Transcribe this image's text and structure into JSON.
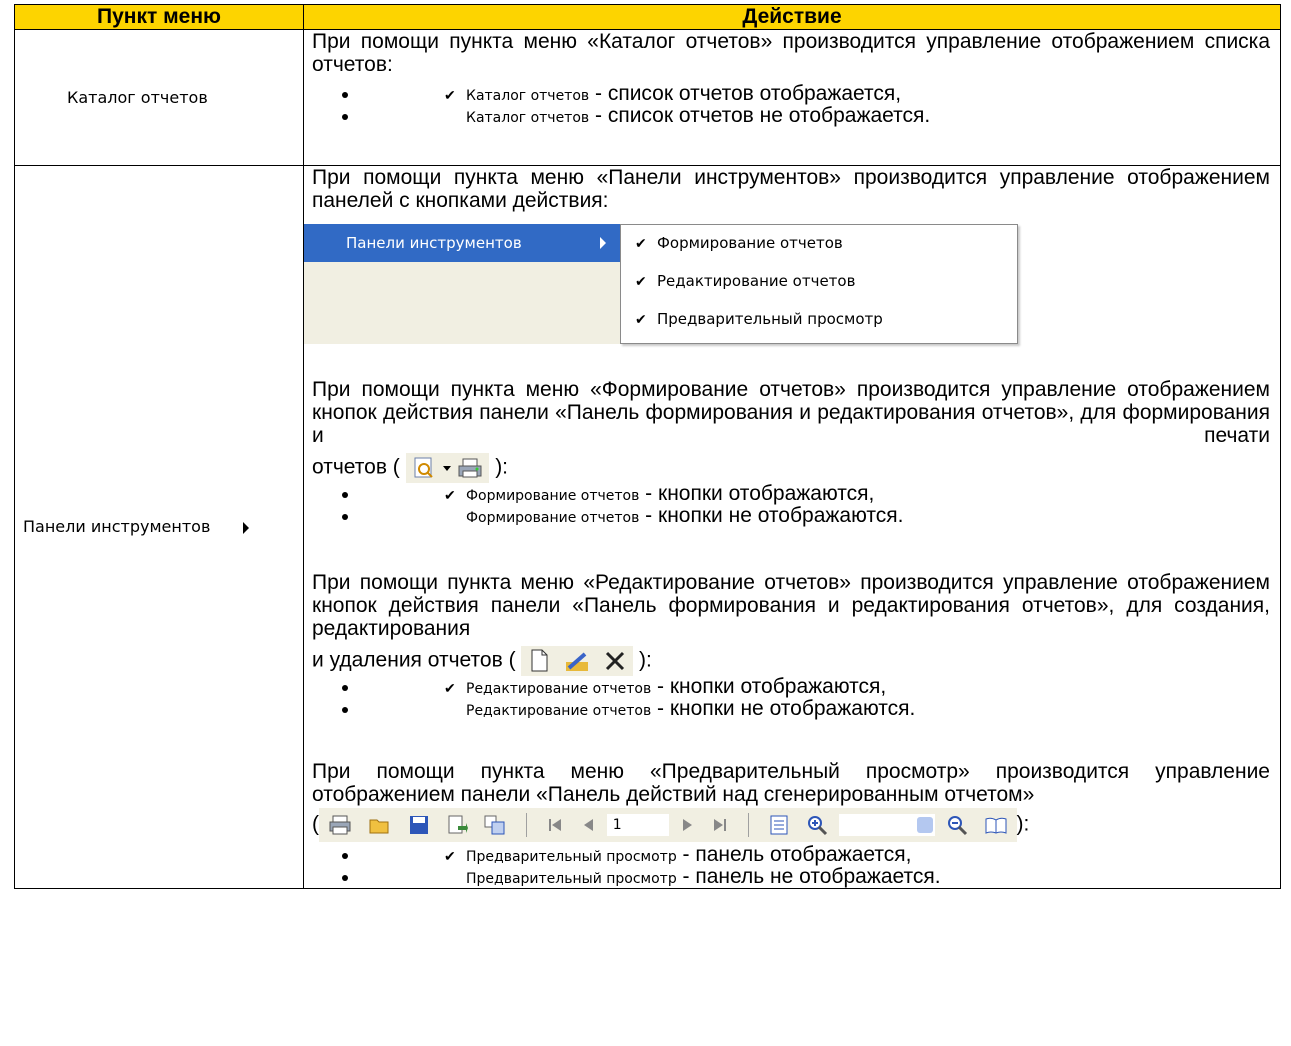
{
  "table": {
    "header": {
      "col1": "Пункт меню",
      "col2": "Действие"
    },
    "row1": {
      "menu_item": "Каталог отчетов",
      "paragraph": "При помощи пункта меню «Каталог отчетов» производится управление отображением списка отчетов:",
      "bullets": [
        {
          "checked": true,
          "ui_label": "Каталог отчетов",
          "text": " - список отчетов отображается,"
        },
        {
          "checked": false,
          "ui_label": "Каталог отчетов",
          "text": " - список отчетов не отображается."
        }
      ]
    },
    "row2": {
      "menu_item": "Панели инструментов",
      "intro": "При помощи пункта меню «Панели инструментов» производится управление отображением панелей с кнопками действия:",
      "submenu": {
        "selected_label": "Панели инструментов",
        "items": [
          "Формирование отчетов",
          "Редактирование отчетов",
          "Предварительный просмотр"
        ]
      },
      "section1": {
        "paragraph": "При помощи пункта меню «Формирование отчетов» производится управление отображением кнопок действия панели «Панель формирования и редактирования отчетов», для формирования и печати",
        "tail_before": "отчетов (",
        "tail_after": "):",
        "icons": [
          "preview-icon",
          "dropdown-arrow-icon",
          "print-icon"
        ],
        "bullets": [
          {
            "checked": true,
            "ui_label": "Формирование отчетов",
            "text": " - кнопки отображаются,"
          },
          {
            "checked": false,
            "ui_label": "Формирование отчетов",
            "text": " - кнопки не отображаются."
          }
        ]
      },
      "section2": {
        "paragraph": "При помощи пункта меню «Редактирование отчетов» производится управление отображением кнопок действия панели «Панель формирования и редактирования отчетов», для создания, редактирования",
        "tail_before": "и удаления отчетов (",
        "tail_after": "):",
        "icons": [
          "new-document-icon",
          "edit-icon",
          "delete-icon"
        ],
        "bullets": [
          {
            "checked": true,
            "ui_label": "Редактирование отчетов",
            "text": " - кнопки отображаются,"
          },
          {
            "checked": false,
            "ui_label": "Редактирование отчетов",
            "text": " - кнопки не отображаются."
          }
        ]
      },
      "section3": {
        "paragraph": "При помощи пункта меню «Предварительный просмотр» производится управление отображением панели «Панель действий над сгенерированным отчетом»",
        "toolbar_open": "(",
        "toolbar_close": "):",
        "page_number": "1",
        "bullets": [
          {
            "checked": true,
            "ui_label": "Предварительный просмотр",
            "text": " - панель отображается,"
          },
          {
            "checked": false,
            "ui_label": "Предварительный просмотр",
            "text": " - панель не отображается."
          }
        ]
      }
    }
  },
  "colors": {
    "header_bg": "#fdd400",
    "menu_highlight": "#316ac5",
    "toolbar_bg": "#f1efe2"
  }
}
